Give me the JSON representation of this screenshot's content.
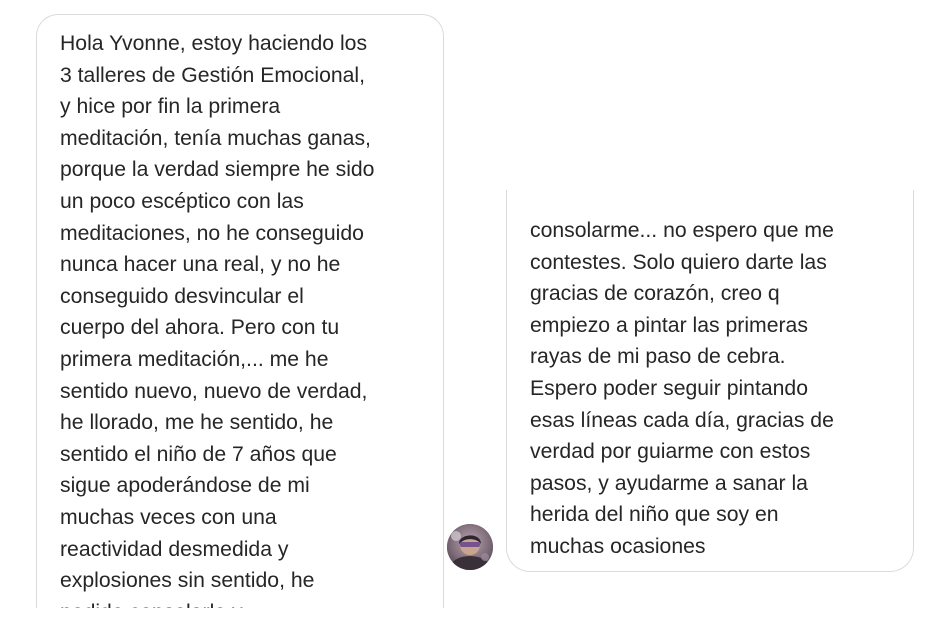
{
  "messages": [
    {
      "side": "left",
      "lines": [
        "Hola Yvonne, estoy haciendo los",
        "3 talleres de Gestión Emocional,",
        "y hice por fin la primera",
        "meditación, tenía muchas ganas,",
        "porque la verdad siempre he sido",
        "un poco escéptico con las",
        "meditaciones, no he conseguido",
        "nunca hacer una real, y no he",
        "conseguido desvincular el",
        "cuerpo del ahora. Pero con tu",
        "primera meditación,... me he",
        "sentido nuevo, nuevo de verdad,",
        "he llorado, me he sentido, he",
        "sentido el niño de 7 años que",
        "sigue apoderándose de mi",
        "muchas veces con una",
        "reactividad desmedida y",
        "explosiones sin sentido, he",
        "podido consolarle y"
      ]
    },
    {
      "side": "right",
      "lines": [
        "consolarme... no espero que me",
        "contestes. Solo quiero darte las",
        "gracias de corazón, creo q",
        "empiezo a pintar las primeras",
        "rayas de mi paso de cebra.",
        "Espero poder seguir pintando",
        "esas líneas cada día, gracias de",
        "verdad por guiarme con estos",
        "pasos, y ayudarme a sanar la",
        "herida del niño que soy en",
        "muchas ocasiones"
      ]
    }
  ],
  "avatar": {
    "icon": "sender-avatar-photo"
  },
  "colors": {
    "text": "#262626",
    "border": "#dbdbdb",
    "background": "#ffffff"
  }
}
